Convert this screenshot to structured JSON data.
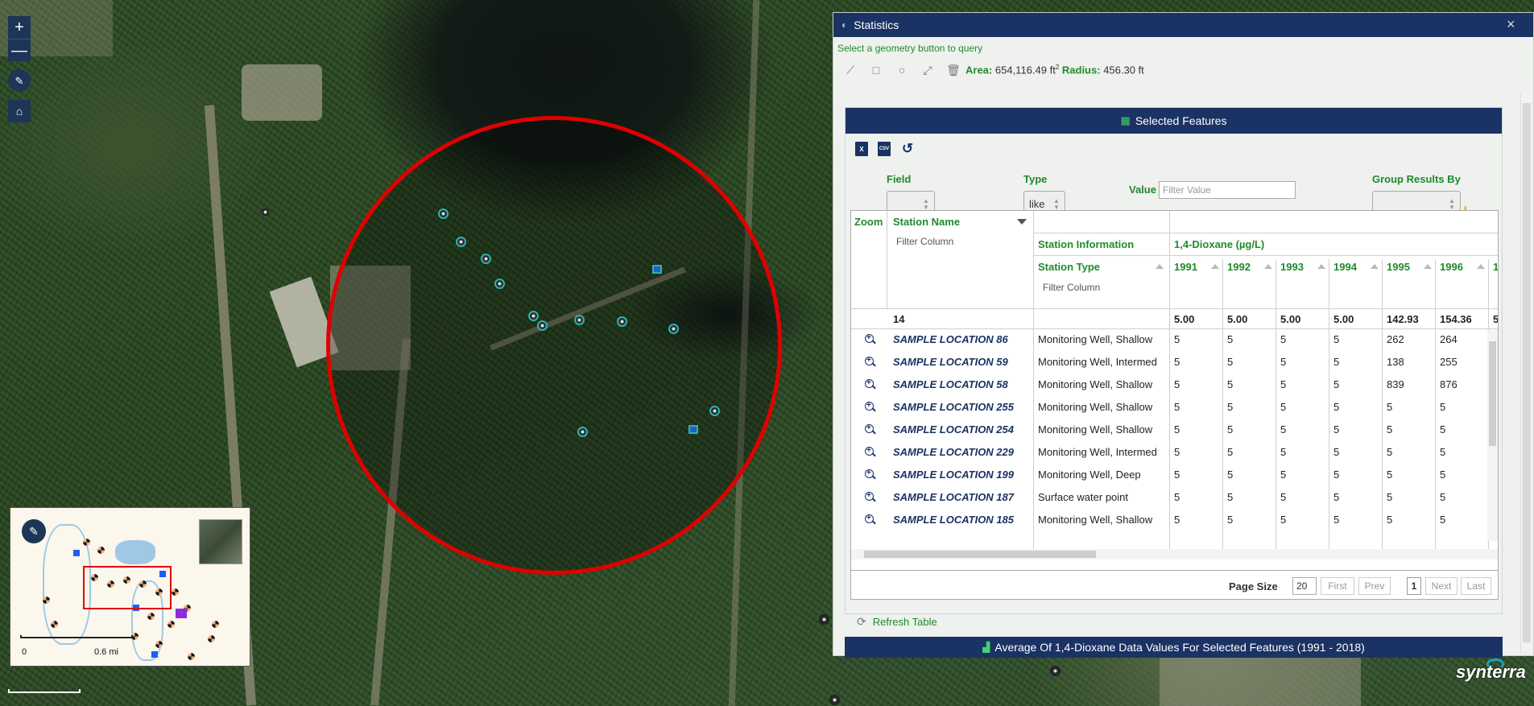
{
  "map": {
    "zoom_in_label": "+",
    "zoom_out_label": "—",
    "draw_icon": "feather-icon",
    "home_icon": "home-icon",
    "overview": {
      "scale_start": "0",
      "scale_distance": "0.6 mi"
    },
    "brand": "synterra"
  },
  "stats": {
    "title": "Statistics",
    "close_label": "×",
    "geometry_hint": "Select a geometry button to query",
    "tools": [
      "polyline-icon",
      "rectangle-icon",
      "circle-icon",
      "extent-icon",
      "trash-icon"
    ],
    "area_label": "Area:",
    "area_value": "654,116.49 ft",
    "area_unit_exp": "2",
    "radius_label": "Radius:",
    "radius_value": "456.30 ft",
    "selected_features": {
      "title": "Selected Features",
      "export_icons": [
        "excel-icon",
        "csv-icon",
        "reset-icon"
      ],
      "excel_label": "X",
      "csv_label": "CSV",
      "reset_glyph": "↺",
      "field_label": "Field",
      "type_label": "Type",
      "type_value": "like",
      "value_label": "Value",
      "value_placeholder": "Filter Value",
      "group_label": "Group Results By",
      "grid": {
        "zoom_header": "Zoom",
        "station_name_header": "Station Name",
        "filter_column": "Filter Column",
        "station_info_header": "Station Information",
        "analyte_header": "1,4-Dioxane (µg/L)",
        "station_type_header": "Station Type",
        "years": [
          "1991",
          "1992",
          "1993",
          "1994",
          "1995",
          "1996",
          "1"
        ],
        "summary": {
          "count": "14",
          "values": [
            "5.00",
            "5.00",
            "5.00",
            "5.00",
            "142.93",
            "154.36",
            "5"
          ]
        },
        "rows": [
          {
            "name": "SAMPLE LOCATION 86",
            "type": "Monitoring Well, Shallow",
            "values": [
              "5",
              "5",
              "5",
              "5",
              "262",
              "264"
            ]
          },
          {
            "name": "SAMPLE LOCATION 59",
            "type": "Monitoring Well, Intermed",
            "values": [
              "5",
              "5",
              "5",
              "5",
              "138",
              "255"
            ]
          },
          {
            "name": "SAMPLE LOCATION 58",
            "type": "Monitoring Well, Shallow",
            "values": [
              "5",
              "5",
              "5",
              "5",
              "839",
              "876"
            ]
          },
          {
            "name": "SAMPLE LOCATION 255",
            "type": "Monitoring Well, Shallow",
            "values": [
              "5",
              "5",
              "5",
              "5",
              "5",
              "5"
            ]
          },
          {
            "name": "SAMPLE LOCATION 254",
            "type": "Monitoring Well, Shallow",
            "values": [
              "5",
              "5",
              "5",
              "5",
              "5",
              "5"
            ]
          },
          {
            "name": "SAMPLE LOCATION 229",
            "type": "Monitoring Well, Intermed",
            "values": [
              "5",
              "5",
              "5",
              "5",
              "5",
              "5"
            ]
          },
          {
            "name": "SAMPLE LOCATION 199",
            "type": "Monitoring Well, Deep",
            "values": [
              "5",
              "5",
              "5",
              "5",
              "5",
              "5"
            ]
          },
          {
            "name": "SAMPLE LOCATION 187",
            "type": "Surface water point",
            "values": [
              "5",
              "5",
              "5",
              "5",
              "5",
              "5"
            ]
          },
          {
            "name": "SAMPLE LOCATION 185",
            "type": "Monitoring Well, Shallow",
            "values": [
              "5",
              "5",
              "5",
              "5",
              "5",
              "5"
            ]
          }
        ]
      },
      "pager": {
        "page_size_label": "Page Size",
        "page_size_value": "20",
        "first": "First",
        "prev": "Prev",
        "page": "1",
        "next": "Next",
        "last": "Last"
      },
      "refresh_label": "Refresh Table"
    },
    "average_title": "Average Of 1,4-Dioxane Data Values For Selected Features (1991 - 2018)"
  }
}
